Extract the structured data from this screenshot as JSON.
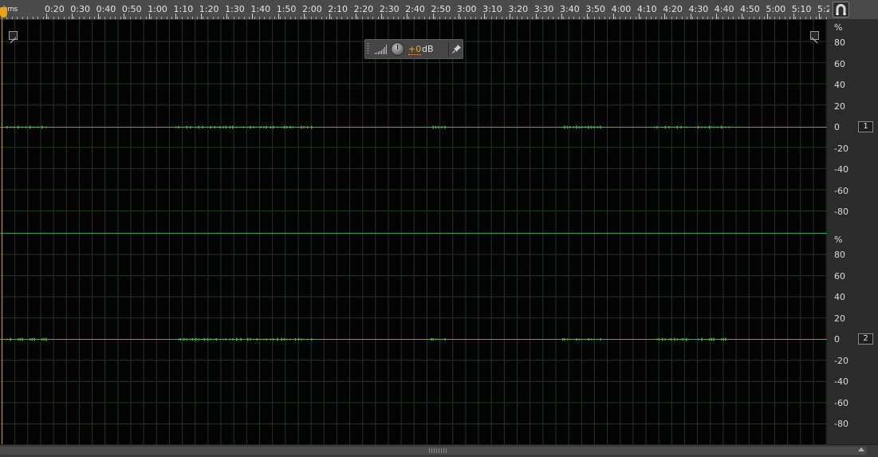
{
  "ruler": {
    "time_format": "hms",
    "labels": [
      "0:20",
      "0:30",
      "0:40",
      "0:50",
      "1:00",
      "1:10",
      "1:20",
      "1:30",
      "1:40",
      "1:50",
      "2:00",
      "2:10",
      "2:20",
      "2:30",
      "2:40",
      "2:50",
      "3:00",
      "3:10",
      "3:20",
      "3:30",
      "3:40",
      "3:50",
      "4:00",
      "4:10",
      "4:20",
      "4:30",
      "4:40",
      "4:50",
      "5:00",
      "5:10",
      "5:2"
    ]
  },
  "toolbar": {
    "snap_icon": "magnet-icon"
  },
  "hud": {
    "meter_icon": "volume-meter-icon",
    "knob_icon": "volume-knob-icon",
    "value": "+0",
    "unit": "dB",
    "pin_icon": "pin-icon"
  },
  "zoom": {
    "in_icon": "zoom-in-icon",
    "out_icon": "zoom-out-icon"
  },
  "scale": {
    "unit": "%",
    "labels": [
      "80",
      "60",
      "40",
      "20",
      "0",
      "-20",
      "-40",
      "-60",
      "-80"
    ]
  },
  "channels": [
    {
      "badge": "1"
    },
    {
      "badge": "2"
    }
  ],
  "colors": {
    "waveform": "#3fb84a",
    "grid": "#1c3a1c",
    "playhead": "#d4a600",
    "background": "#030303"
  }
}
